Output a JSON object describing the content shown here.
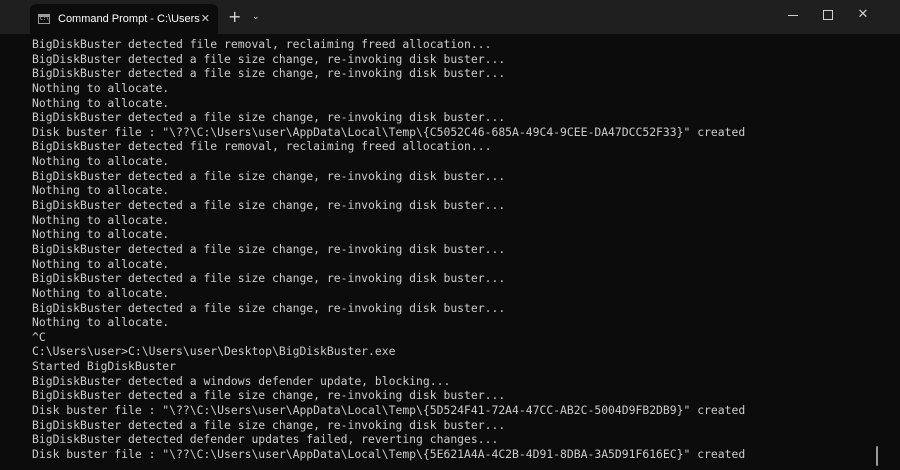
{
  "tab": {
    "icon": "cmd-icon",
    "icon_text": "C:\\",
    "title": "Command Prompt - C:\\Users\\",
    "close": "✕"
  },
  "titlebar": {
    "new_tab": "+",
    "dropdown": "⌄",
    "close": "✕"
  },
  "terminal": {
    "lines": [
      "BigDiskBuster detected file removal, reclaiming freed allocation...",
      "BigDiskBuster detected a file size change, re-invoking disk buster...",
      "BigDiskBuster detected a file size change, re-invoking disk buster...",
      "Nothing to allocate.",
      "Nothing to allocate.",
      "BigDiskBuster detected a file size change, re-invoking disk buster...",
      "Disk buster file : \"\\??\\C:\\Users\\user\\AppData\\Local\\Temp\\{C5052C46-685A-49C4-9CEE-DA47DCC52F33}\" created",
      "BigDiskBuster detected file removal, reclaiming freed allocation...",
      "Nothing to allocate.",
      "BigDiskBuster detected a file size change, re-invoking disk buster...",
      "Nothing to allocate.",
      "BigDiskBuster detected a file size change, re-invoking disk buster...",
      "Nothing to allocate.",
      "Nothing to allocate.",
      "BigDiskBuster detected a file size change, re-invoking disk buster...",
      "Nothing to allocate.",
      "BigDiskBuster detected a file size change, re-invoking disk buster...",
      "Nothing to allocate.",
      "BigDiskBuster detected a file size change, re-invoking disk buster...",
      "Nothing to allocate.",
      "^C",
      "C:\\Users\\user>C:\\Users\\user\\Desktop\\BigDiskBuster.exe",
      "Started BigDiskBuster",
      "BigDiskBuster detected a windows defender update, blocking...",
      "BigDiskBuster detected a file size change, re-invoking disk buster...",
      "Disk buster file : \"\\??\\C:\\Users\\user\\AppData\\Local\\Temp\\{5D524F41-72A4-47CC-AB2C-5004D9FB2DB9}\" created",
      "BigDiskBuster detected a file size change, re-invoking disk buster...",
      "BigDiskBuster detected defender updates failed, reverting changes...",
      "Disk buster file : \"\\??\\C:\\Users\\user\\AppData\\Local\\Temp\\{5E621A4A-4C2B-4D91-8DBA-3A5D91F616EC}\" created"
    ]
  }
}
